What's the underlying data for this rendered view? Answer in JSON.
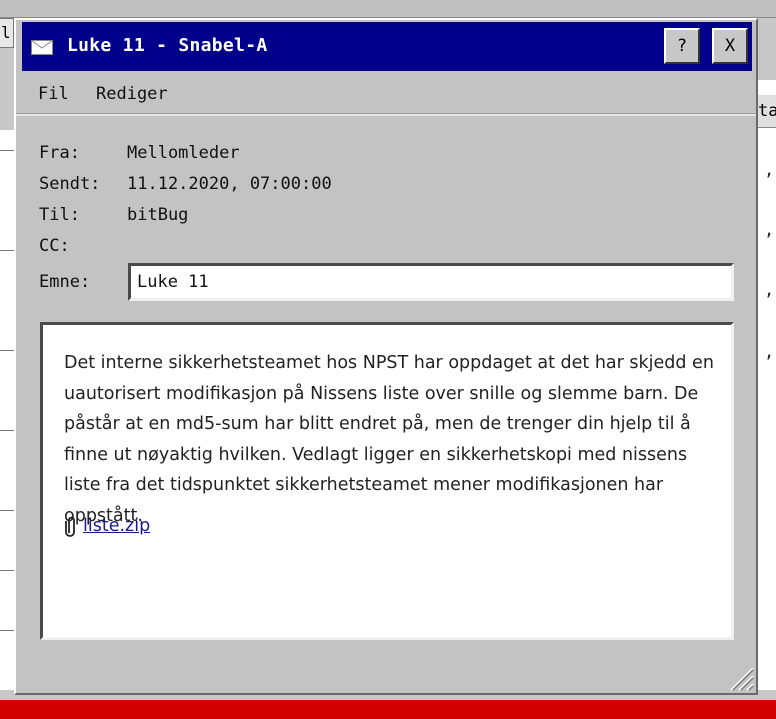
{
  "background": {
    "tab_fragment": "l",
    "right_header_fragment": "ta",
    "right_marks": [
      ",",
      ",",
      ",",
      ","
    ]
  },
  "window": {
    "title": "Luke 11 - Snabel-A",
    "help_label": "?",
    "close_label": "X"
  },
  "menu": {
    "items": [
      "Fil",
      "Rediger"
    ]
  },
  "email": {
    "from_label": "Fra:",
    "from_value": "Mellomleder",
    "sent_label": "Sendt:",
    "sent_value": "11.12.2020, 07:00:00",
    "to_label": "Til:",
    "to_value": "bitBug",
    "cc_label": "CC:",
    "cc_value": "",
    "subject_label": "Emne:",
    "subject_value": "Luke 11",
    "body": "Det interne sikkerhetsteamet hos NPST har oppdaget at det har skjedd en uautorisert modifikasjon på Nissens liste over snille og slemme barn. De påstår at en md5-sum har blitt endret på, men de trenger din hjelp til å finne ut nøyaktig hvilken. Vedlagt ligger en sikkerhetskopi med nissens liste fra det tidspunktet sikkerhetsteamet mener modifikasjonen har oppstått.",
    "attachment": "liste.zip"
  },
  "colors": {
    "titlebar": "#00008b",
    "window_bg": "#c3c3c3",
    "link": "#1a1a8c",
    "bottom_bar": "#d40000"
  },
  "icons": [
    "mail-icon",
    "paperclip-icon",
    "resize-grip-icon"
  ]
}
